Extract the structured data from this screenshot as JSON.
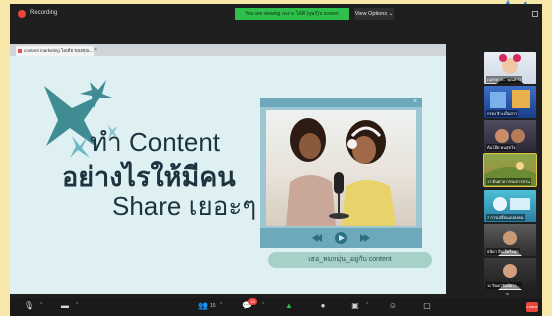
{
  "top": {
    "recording": "Recording",
    "banner": "You are viewing เหงาะ ได้ดี (บุษร์)'s screen",
    "view_options": "View Options"
  },
  "browser": {
    "tab_title": "content marketing ไอเดีย ของคุณ..."
  },
  "slide": {
    "title_line1": "ทำ Content",
    "title_line2": "อย่างไรให้มีคน",
    "title_line3": "Share เยอะๆ",
    "caption": "เธอ_หมกมุ่น_อยู่กับ content"
  },
  "gallery": {
    "tiles": [
      {
        "name": "เนตรดาว... คุณดาว"
      },
      {
        "name": "กร่อง จิวะเป็นสาว"
      },
      {
        "name": "ต้นโอ๊ต คนสุขใจ"
      },
      {
        "name": "17 ต้นตาล กรรมการสวน"
      },
      {
        "name": "7 การเปลี่ยนแปลงคน"
      },
      {
        "name": "ธนิดา สิบเจ็ดใจทุก"
      },
      {
        "name": "11 จินดารัตน์ดาว ..."
      }
    ]
  },
  "toolbar": {
    "participants_count": "15",
    "chat_badge": "10",
    "leave": "Leave"
  },
  "colors": {
    "frame": "#f7e7a8",
    "slide_bg": "#dff0f3",
    "title_text": "#1d3340",
    "banner_green": "#2fbf4a",
    "accent_teal": "#5bb3a5"
  }
}
